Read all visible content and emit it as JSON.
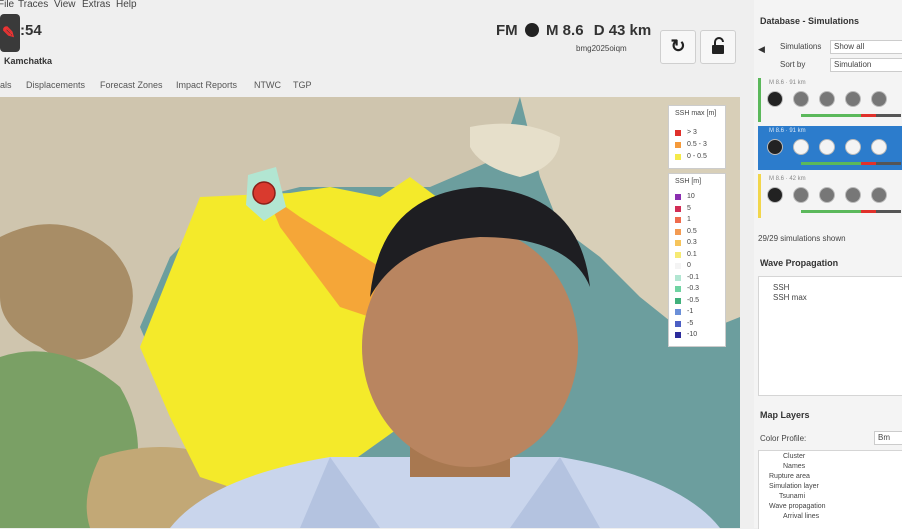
{
  "menu": [
    "File",
    "Traces",
    "View",
    "Extras",
    "Help"
  ],
  "header": {
    "event_number": ":54",
    "event_name": "Kamchatka"
  },
  "quake": {
    "label": "FM",
    "magnitude": "M 8.6",
    "depth": "D 43 km",
    "id": "bmg2025oiqm"
  },
  "tabs": [
    "ials",
    "Displacements",
    "Forecast Zones",
    "Impact Reports",
    "NTWC",
    "TGP"
  ],
  "legend_ssh_max": {
    "title": "SSH max [m]",
    "items": [
      {
        "label": "> 3",
        "color": "#e0312b"
      },
      {
        "label": "0.5 - 3",
        "color": "#f59a3b"
      },
      {
        "label": "0 - 0.5",
        "color": "#f5ea4a"
      }
    ]
  },
  "legend_ssh": {
    "title": "SSH [m]",
    "items": [
      {
        "label": "10",
        "color": "#8b2fb0"
      },
      {
        "label": "5",
        "color": "#d22d55"
      },
      {
        "label": "1",
        "color": "#ef6b4c"
      },
      {
        "label": "0.5",
        "color": "#f39b52"
      },
      {
        "label": "0.3",
        "color": "#f6c45b"
      },
      {
        "label": "0.1",
        "color": "#f6ea74"
      },
      {
        "label": "0",
        "color": "#f4f4f4"
      },
      {
        "label": "-0.1",
        "color": "#b2e6d2"
      },
      {
        "label": "-0.3",
        "color": "#6fd3a2"
      },
      {
        "label": "-0.5",
        "color": "#40b07b"
      },
      {
        "label": "-1",
        "color": "#6b8fd8"
      },
      {
        "label": "-5",
        "color": "#4c5fc4"
      },
      {
        "label": "-10",
        "color": "#2c2c9c"
      }
    ]
  },
  "sidebar": {
    "db_title": "Database - Simulations",
    "simulations_label": "Simulations",
    "simulations_value": "Show all",
    "sort_label": "Sort by",
    "sort_value": "Simulation",
    "sim_rows": [
      {
        "meta": "M 8.6 · 91 km"
      },
      {
        "meta": "M 8.6 · 91 km"
      },
      {
        "meta": "M 8.6 · 42 km"
      }
    ],
    "count": "29/29 simulations shown",
    "wave_title": "Wave Propagation",
    "wave_items": [
      "SSH",
      "SSH max"
    ],
    "layers_title": "Map Layers",
    "color_profile_label": "Color Profile:",
    "color_profile_value": "Bm",
    "layer_tree": [
      "Cluster",
      "Names",
      "Rupture area",
      "Simulation layer",
      "Tsunami",
      "Wave propagation",
      "Arrival lines"
    ]
  },
  "colors": {
    "accent_blue": "#2c7ccc",
    "accent_green": "#5bb85b",
    "accent_yellow": "#f2d64b",
    "epicenter": "#d93a2e"
  }
}
